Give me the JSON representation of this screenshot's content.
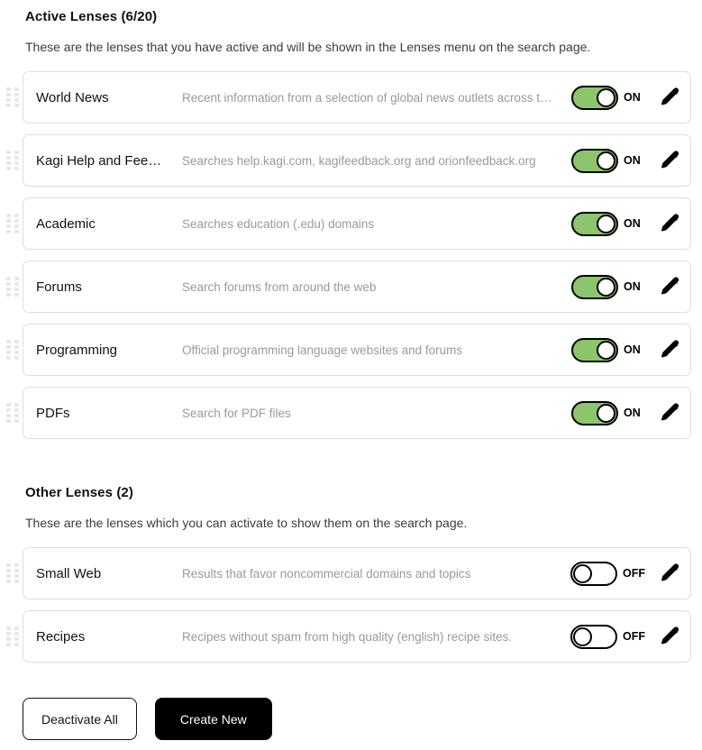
{
  "active_section": {
    "title": "Active Lenses (6/20)",
    "description": "These are the lenses that you have active and will be shown in the Lenses menu on the search page.",
    "lenses": [
      {
        "name": "World News",
        "description": "Recent information from a selection of global news outlets across t…",
        "state": "on",
        "state_label": "ON"
      },
      {
        "name": "Kagi Help and Fee…",
        "description": "Searches help.kagi.com, kagifeedback.org and orionfeedback.org",
        "state": "on",
        "state_label": "ON"
      },
      {
        "name": "Academic",
        "description": "Searches education (.edu) domains",
        "state": "on",
        "state_label": "ON"
      },
      {
        "name": "Forums",
        "description": "Search forums from around the web",
        "state": "on",
        "state_label": "ON"
      },
      {
        "name": "Programming",
        "description": "Official programming language websites and forums",
        "state": "on",
        "state_label": "ON"
      },
      {
        "name": "PDFs",
        "description": "Search for PDF files",
        "state": "on",
        "state_label": "ON"
      }
    ]
  },
  "other_section": {
    "title": "Other Lenses (2)",
    "description": "These are the lenses which you can activate to show them on the search page.",
    "lenses": [
      {
        "name": "Small Web",
        "description": "Results that favor noncommercial domains and topics",
        "state": "off",
        "state_label": "OFF"
      },
      {
        "name": "Recipes",
        "description": "Recipes without spam from high quality (english) recipe sites.",
        "state": "off",
        "state_label": "OFF"
      }
    ]
  },
  "footer": {
    "deactivate_all_label": "Deactivate All",
    "create_new_label": "Create New"
  },
  "colors": {
    "toggle_on": "#8cc56b",
    "toggle_border": "#000000",
    "card_border": "#dedede",
    "description_text": "#9a9a9a",
    "primary_button_bg": "#000000"
  },
  "icons": {
    "drag_handle": "drag-handle-icon",
    "edit": "pencil-icon"
  }
}
